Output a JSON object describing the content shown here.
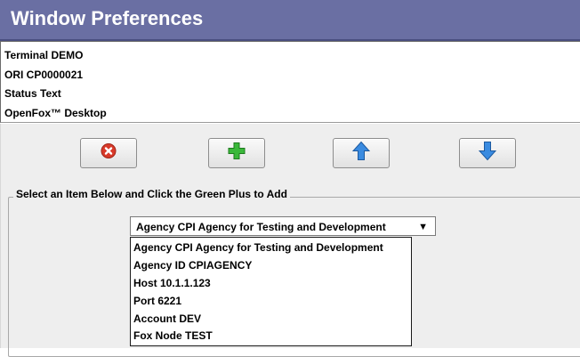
{
  "window": {
    "title": "Window Preferences"
  },
  "info": {
    "lines": [
      "Terminal DEMO",
      "ORI CP0000021",
      "Status Text",
      "OpenFox™ Desktop"
    ]
  },
  "toolbar": {
    "buttons": [
      {
        "name": "remove-button",
        "icon": "red-x-icon"
      },
      {
        "name": "add-button",
        "icon": "green-plus-icon"
      },
      {
        "name": "move-up-button",
        "icon": "blue-up-arrow-icon"
      },
      {
        "name": "move-down-button",
        "icon": "blue-down-arrow-icon"
      }
    ]
  },
  "group": {
    "legend": "Select an Item Below and Click the Green Plus to Add"
  },
  "combo": {
    "selected": "Agency CPI Agency for Testing and Development",
    "options": [
      "Agency CPI Agency for Testing and Development",
      "Agency ID CPIAGENCY",
      "Host 10.1.1.123",
      "Port 6221",
      "Account DEV",
      "Fox Node TEST"
    ]
  },
  "colors": {
    "titlebar": "#6a6fa3",
    "panel": "#eeeeee",
    "accent_green": "#3ab83a",
    "accent_blue": "#3a8be0",
    "accent_red": "#d83a2a"
  }
}
